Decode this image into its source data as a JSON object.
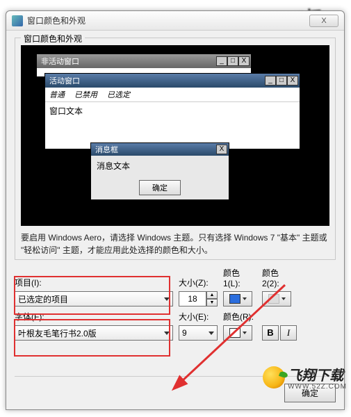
{
  "window": {
    "title": "窗口颜色和外观",
    "close": "X"
  },
  "group": {
    "label": "窗口颜色和外观"
  },
  "preview": {
    "inactive": {
      "title": "非活动窗口"
    },
    "active": {
      "title": "活动窗口",
      "menu": {
        "m1": "普通",
        "m2": "已禁用",
        "m3": "已选定"
      },
      "body": "窗口文本"
    },
    "msgbox": {
      "title": "消息框",
      "body": "消息文本",
      "ok": "确定"
    },
    "btns": {
      "min": "_",
      "max": "□",
      "close": "X"
    }
  },
  "desc": "要启用 Windows Aero，请选择 Windows 主题。只有选择 Windows 7 \"基本\" 主题或 \"轻松访问\" 主题，才能应用此处选择的颜色和大小。",
  "item": {
    "label": "项目(I):",
    "value": "已选定的项目"
  },
  "size1": {
    "label": "大小(Z):",
    "value": "18"
  },
  "color1": {
    "label": "颜色  1(L):",
    "hex": "#2a6dde"
  },
  "color2": {
    "label": "颜色  2(2):"
  },
  "font": {
    "label": "字体(F):",
    "value": "叶根友毛笔行书2.0版"
  },
  "size2": {
    "label": "大小(E):",
    "value": "9"
  },
  "colorR": {
    "label": "颜色(R):",
    "hex": "#ffffff"
  },
  "style": {
    "bold": "B",
    "italic": "I"
  },
  "buttons": {
    "ok": "确定"
  },
  "logo": {
    "t1": "飞翔下载",
    "t2": "WWW.52Z.COM"
  }
}
